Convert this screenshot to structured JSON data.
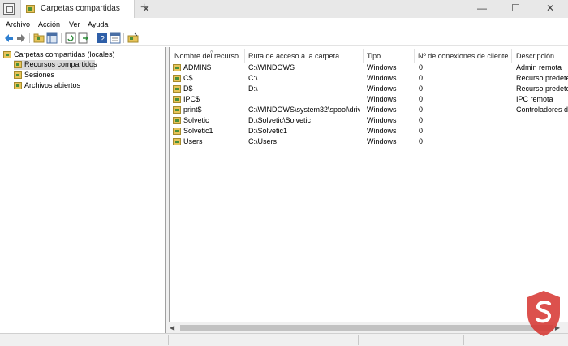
{
  "window": {
    "tab_title": "Carpetas compartidas",
    "tab_close": "✕",
    "new_tab": "+",
    "minimize": "—",
    "maximize": "☐",
    "close": "✕"
  },
  "menu": [
    "Archivo",
    "Acción",
    "Ver",
    "Ayuda"
  ],
  "toolbar": {
    "icons": [
      "back-arrow-icon",
      "forward-arrow-icon",
      "folder-icon",
      "show-tree-icon",
      "refresh-icon",
      "export-list-icon",
      "help-icon",
      "properties-icon",
      "shared-folder-icon"
    ]
  },
  "tree": [
    {
      "label": "Carpetas compartidas (locales)",
      "selected": false
    },
    {
      "label": "Recursos compartidos",
      "selected": true
    },
    {
      "label": "Sesiones",
      "selected": false
    },
    {
      "label": "Archivos abiertos",
      "selected": false
    }
  ],
  "table": {
    "columns": [
      "Nombre del recurso",
      "Ruta de acceso a la carpeta",
      "Tipo",
      "Nº de conexiones de cliente",
      "Descripción"
    ],
    "rows": [
      [
        "ADMIN$",
        "C:\\WINDOWS",
        "Windows",
        "0",
        "Admin remota"
      ],
      [
        "C$",
        "C:\\",
        "Windows",
        "0",
        "Recurso predeter"
      ],
      [
        "D$",
        "D:\\",
        "Windows",
        "0",
        "Recurso predeter"
      ],
      [
        "IPC$",
        "",
        "Windows",
        "0",
        "IPC remota"
      ],
      [
        "print$",
        "C:\\WINDOWS\\system32\\spool\\driv",
        "Windows",
        "0",
        "Controladores de"
      ],
      [
        "Solvetic",
        "D:\\Solvetic\\Solvetic",
        "Windows",
        "0",
        ""
      ],
      [
        "Solvetic1",
        "D:\\Solvetic1",
        "Windows",
        "0",
        ""
      ],
      [
        "Users",
        "C:\\Users",
        "Windows",
        "0",
        ""
      ]
    ]
  },
  "colors": {
    "selection": "#d9d9d9",
    "folder": "#e7c45a",
    "titlebar": "#e8e8e8",
    "watermark_red": "#d6322e"
  }
}
